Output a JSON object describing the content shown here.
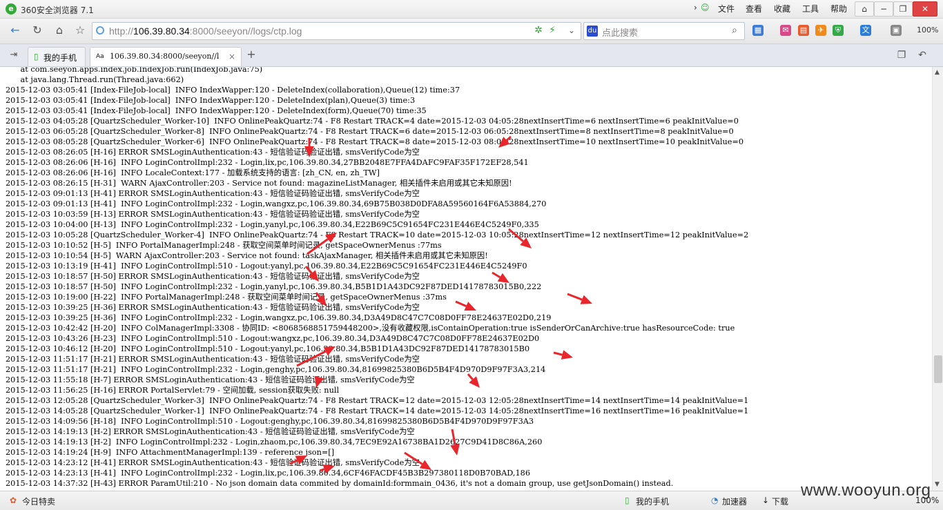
{
  "window": {
    "title": "360安全浏览器 7.1",
    "menus": [
      "文件",
      "查看",
      "收藏",
      "工具",
      "帮助"
    ]
  },
  "navbar": {
    "url_prefix": "http://",
    "url_host": "106.39.80.34",
    "url_rest": ":8000/seeyon//logs/ctp.log",
    "search_placeholder": "点此搜索",
    "zoom": "100%"
  },
  "tabs": [
    {
      "label": "我的手机"
    },
    {
      "label": "106.39.80.34:8000/seeyon//l"
    }
  ],
  "log_lines": [
    "      at com.seeyon.apps.index.job.IndexJob.run(IndexJob.java:75)",
    "      at java.lang.Thread.run(Thread.java:662)",
    "2015-12-03 03:05:41 [Index-FileJob-local]  INFO IndexWapper:120 - DeleteIndex(collaboration),Queue(12) time:37",
    "2015-12-03 03:05:41 [Index-FileJob-local]  INFO IndexWapper:120 - DeleteIndex(plan),Queue(3) time:3",
    "2015-12-03 03:05:41 [Index-FileJob-local]  INFO IndexWapper:120 - DeleteIndex(form),Queue(70) time:35",
    "2015-12-03 04:05:28 [QuartzScheduler_Worker-10]  INFO OnlinePeakQuartz:74 - F8 Restart TRACK=4 date=2015-12-03 04:05:28nextInsertTime=6 nextInsertTime=6 peakInitValue=0",
    "2015-12-03 06:05:28 [QuartzScheduler_Worker-8]  INFO OnlinePeakQuartz:74 - F8 Restart TRACK=6 date=2015-12-03 06:05:28nextInsertTime=8 nextInsertTime=8 peakInitValue=0",
    "2015-12-03 08:05:28 [QuartzScheduler_Worker-6]  INFO OnlinePeakQuartz:74 - F8 Restart TRACK=8 date=2015-12-03 08:05:28nextInsertTime=10 nextInsertTime=10 peakInitValue=0",
    "2015-12-03 08:26:05 [H-16] ERROR SMSLoginAuthentication:43 - 短信验证码验证出错, smsVerifyCode为空",
    "2015-12-03 08:26:06 [H-16]  INFO LoginControlImpl:232 - Login,lix,pc,106.39.80.34,27BB2048E7FFA4DAFC9FAF35F172EF28,541",
    "2015-12-03 08:26:06 [H-16]  INFO LocaleContext:177 - 加载系统支持的语言: [zh_CN, en, zh_TW]",
    "2015-12-03 08:26:15 [H-31]  WARN AjaxController:203 - Service not found: magazineListManager, 相关插件未启用或其它未知原因!",
    "2015-12-03 09:01:13 [H-41] ERROR SMSLoginAuthentication:43 - 短信验证码验证出错, smsVerifyCode为空",
    "2015-12-03 09:01:13 [H-41]  INFO LoginControlImpl:232 - Login,wangxz,pc,106.39.80.34,69B75B038D0DFA8A59560164F6A53884,270",
    "2015-12-03 10:03:59 [H-13] ERROR SMSLoginAuthentication:43 - 短信验证码验证出错, smsVerifyCode为空",
    "2015-12-03 10:04:00 [H-13]  INFO LoginControlImpl:232 - Login,yanyl,pc,106.39.80.34,E22B69C5C91654FC231E446E4C5249F0,335",
    "2015-12-03 10:05:28 [QuartzScheduler_Worker-4]  INFO OnlinePeakQuartz:74 - F8 Restart TRACK=10 date=2015-12-03 10:05:28nextInsertTime=12 nextInsertTime=12 peakInitValue=2",
    "2015-12-03 10:10:52 [H-5]  INFO PortalManagerImpl:248 - 获取空间菜单时间记录, getSpaceOwnerMenus :77ms",
    "2015-12-03 10:10:54 [H-5]  WARN AjaxController:203 - Service not found: taskAjaxManager, 相关插件未启用或其它未知原因!",
    "2015-12-03 10:13:19 [H-41]  INFO LoginControlImpl:510 - Logout:yanyl,pc,106.39.80.34,E22B69C5C91654FC231E446E4C5249F0",
    "2015-12-03 10:18:57 [H-50] ERROR SMSLoginAuthentication:43 - 短信验证码验证出错, smsVerifyCode为空",
    "2015-12-03 10:18:57 [H-50]  INFO LoginControlImpl:232 - Login,yanyl,pc,106.39.80.34,B5B1D1A43DC92F87DED14178783015B0,222",
    "2015-12-03 10:19:00 [H-22]  INFO PortalManagerImpl:248 - 获取空间菜单时间记录, getSpaceOwnerMenus :37ms",
    "2015-12-03 10:39:25 [H-36] ERROR SMSLoginAuthentication:43 - 短信验证码验证出错, smsVerifyCode为空",
    "2015-12-03 10:39:25 [H-36]  INFO LoginControlImpl:232 - Login,wangxz,pc,106.39.80.34,D3A49D8C47C7C08D0FF78E24637E02D0,219",
    "2015-12-03 10:42:42 [H-20]  INFO ColManagerImpl:3308 - 协同ID: <8068568851759448200>,没有收藏权限,isContainOperation:true isSenderOrCanArchive:true hasResourceCode: true",
    "2015-12-03 10:43:26 [H-23]  INFO LoginControlImpl:510 - Logout:wangxz,pc,106.39.80.34,D3A49D8C47C7C08D0FF78E24637E02D0",
    "2015-12-03 10:46:12 [H-20]  INFO LoginControlImpl:510 - Logout:yanyl,pc,106.39.80.34,B5B1D1A43DC92F87DED14178783015B0",
    "2015-12-03 11:51:17 [H-21] ERROR SMSLoginAuthentication:43 - 短信验证码验证出错, smsVerifyCode为空",
    "2015-12-03 11:51:17 [H-21]  INFO LoginControlImpl:232 - Login,genghy,pc,106.39.80.34,81699825380B6D5B4F4D970D9F97F3A3,214",
    "2015-12-03 11:55:18 [H-7] ERROR SMSLoginAuthentication:43 - 短信验证码验证出错, smsVerifyCode为空",
    "2015-12-03 11:56:25 [H-16] ERROR PortalServlet:79 - 空间加载, session获取失败: null",
    "2015-12-03 12:05:28 [QuartzScheduler_Worker-3]  INFO OnlinePeakQuartz:74 - F8 Restart TRACK=12 date=2015-12-03 12:05:28nextInsertTime=14 nextInsertTime=14 peakInitValue=1",
    "2015-12-03 14:05:28 [QuartzScheduler_Worker-1]  INFO OnlinePeakQuartz:74 - F8 Restart TRACK=14 date=2015-12-03 14:05:28nextInsertTime=16 nextInsertTime=16 peakInitValue=1",
    "2015-12-03 14:09:56 [H-18]  INFO LoginControlImpl:510 - Logout:genghy,pc,106.39.80.34,81699825380B6D5B4F4D970D9F97F3A3",
    "2015-12-03 14:19:13 [H-2] ERROR SMSLoginAuthentication:43 - 短信验证码验证出错, smsVerifyCode为空",
    "2015-12-03 14:19:13 [H-2]  INFO LoginControlImpl:232 - Login,zhaom,pc,106.39.80.34,7EC9E92A16738BA1D2627C9D41D8C86A,260",
    "2015-12-03 14:19:24 [H-9]  INFO AttachmentManagerImpl:139 - reference json=[]",
    "2015-12-03 14:23:12 [H-41] ERROR SMSLoginAuthentication:43 - 短信验证码验证出错, smsVerifyCode为空",
    "2015-12-03 14:23:13 [H-41]  INFO LoginControlImpl:232 - Login,lix,pc,106.39.80.34,6CF46FACDF45B3B297380118D0B70BAD,186",
    "2015-12-03 14:37:32 [H-43] ERROR ParamUtil:210 - No json domain data commited by domainId:formmain_0436, it's not a domain group, use getJsonDomain() instead."
  ],
  "statusbar": {
    "left": "今日特卖",
    "phone": "我的手机",
    "accelerator": "加速器",
    "download": "下载",
    "zoom": "100%"
  },
  "watermark": "www.wooyun.org",
  "colors": {
    "annotation_arrow": "#e8262b",
    "tab_bar": "#e4e8ee"
  }
}
